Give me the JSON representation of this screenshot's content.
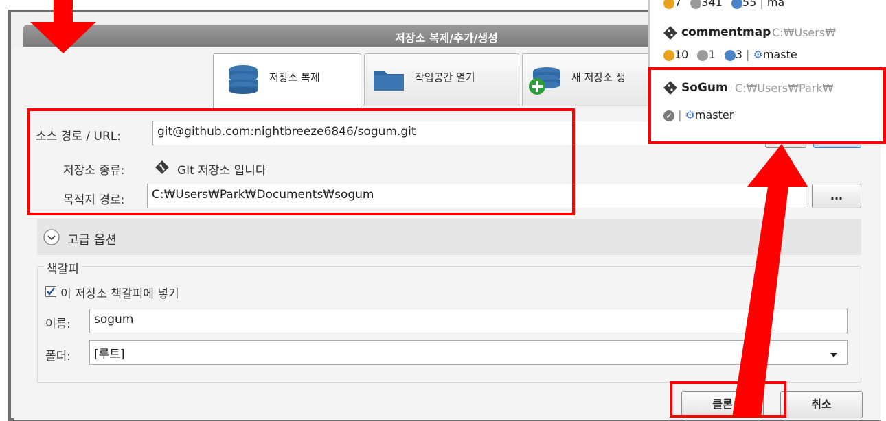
{
  "dialog": {
    "title": "저장소 복제/추가/생성",
    "tabs": [
      {
        "label": "저장소 복제",
        "icon": "database-icon",
        "active": true
      },
      {
        "label": "작업공간 열기",
        "icon": "folder-icon",
        "active": false
      },
      {
        "label": "새 저장소 생",
        "icon": "new-database-icon",
        "active": false
      }
    ]
  },
  "form": {
    "source_label": "소스 경로 / URL:",
    "source_value": "git@github.com:nightbreeze6846/sogum.git",
    "repo_type_label": "저장소 종류:",
    "repo_type_value": "GIt 저장소 입니다",
    "dest_label": "목적지 경로:",
    "dest_value": "C:₩Users₩Park₩Documents₩sogum",
    "browse_label": "..."
  },
  "advanced": {
    "label": "고급 옵션",
    "icon": "chevron-down-icon"
  },
  "bookmark": {
    "group_label": "책갈피",
    "checkbox_label": "이 저장소 책갈피에 넣기",
    "checked": true,
    "name_label": "이름:",
    "name_value": "sogum",
    "folder_label": "폴더:",
    "folder_value": "[루트]"
  },
  "buttons": {
    "clone": "클론",
    "cancel": "취소"
  },
  "repo_list": [
    {
      "name": "",
      "path": "",
      "status_counts": [
        "7",
        "341",
        "55"
      ],
      "branch": "ma"
    },
    {
      "name": "commentmap",
      "path": "C:₩Users₩",
      "status_counts": [
        "10",
        "1",
        "3"
      ],
      "branch": "maste"
    },
    {
      "name": "SoGum",
      "path": "C:₩Users₩Park₩",
      "status_counts": [],
      "branch": "master"
    }
  ],
  "colors": {
    "highlight": "#ff0000",
    "titlebar": "#8a8a8a"
  }
}
